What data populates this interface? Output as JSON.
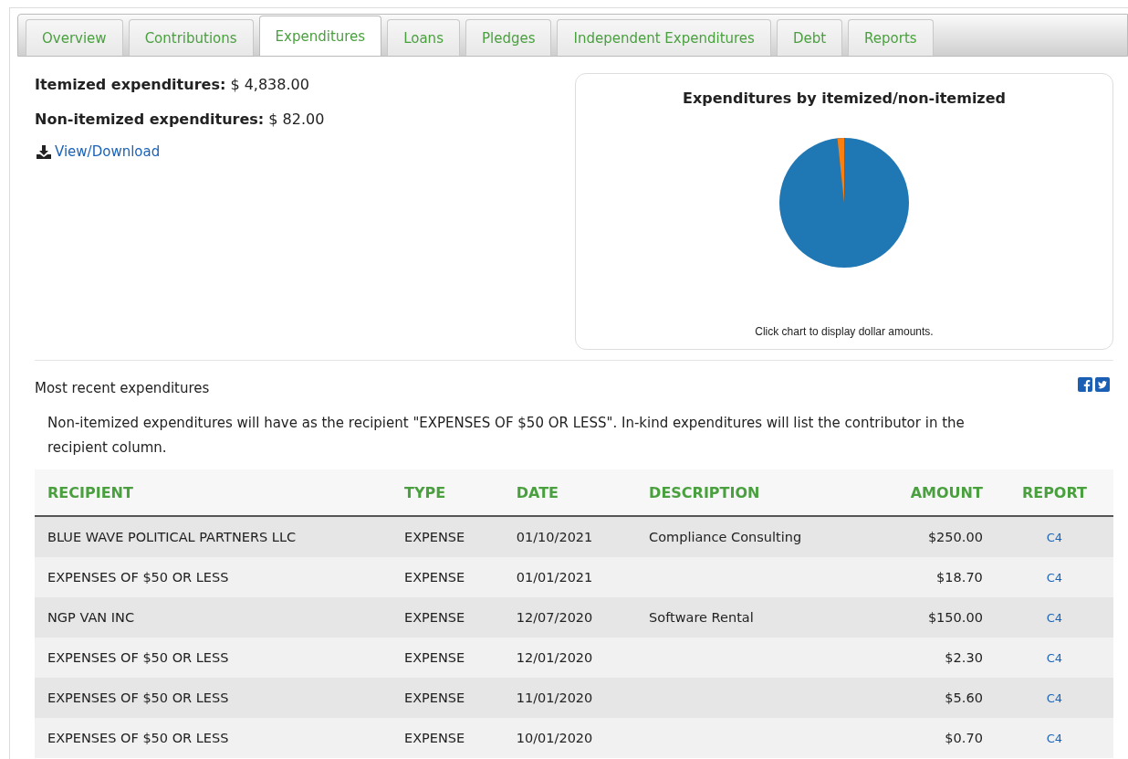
{
  "tabs": [
    {
      "label": "Overview",
      "selected": false
    },
    {
      "label": "Contributions",
      "selected": false
    },
    {
      "label": "Expenditures",
      "selected": true
    },
    {
      "label": "Loans",
      "selected": false
    },
    {
      "label": "Pledges",
      "selected": false
    },
    {
      "label": "Independent Expenditures",
      "selected": false
    },
    {
      "label": "Debt",
      "selected": false
    },
    {
      "label": "Reports",
      "selected": false
    }
  ],
  "summary": [
    {
      "label": "Itemized expenditures:",
      "value": "$ 4,838.00"
    },
    {
      "label": "Non-itemized expenditures:",
      "value": "$ 82.00"
    }
  ],
  "download_link": "View/Download",
  "chart_card": {
    "title": "Expenditures by itemized/non-itemized",
    "caption": "Click chart to display dollar amounts."
  },
  "section_title": "Most recent expenditures",
  "note": "Non-itemized expenditures will have as the recipient \"EXPENSES OF $50 OR LESS\". In-kind expenditures will list the contributor in the recipient column.",
  "table": {
    "columns": [
      "RECIPIENT",
      "TYPE",
      "DATE",
      "DESCRIPTION",
      "AMOUNT",
      "REPORT"
    ],
    "rows": [
      [
        "BLUE WAVE POLITICAL PARTNERS LLC",
        "EXPENSE",
        "01/10/2021",
        "Compliance Consulting",
        "$250.00",
        "C4"
      ],
      [
        "EXPENSES OF $50 OR LESS",
        "EXPENSE",
        "01/01/2021",
        "",
        "$18.70",
        "C4"
      ],
      [
        "NGP VAN INC",
        "EXPENSE",
        "12/07/2020",
        "Software Rental",
        "$150.00",
        "C4"
      ],
      [
        "EXPENSES OF $50 OR LESS",
        "EXPENSE",
        "12/01/2020",
        "",
        "$2.30",
        "C4"
      ],
      [
        "EXPENSES OF $50 OR LESS",
        "EXPENSE",
        "11/01/2020",
        "",
        "$5.60",
        "C4"
      ],
      [
        "EXPENSES OF $50 OR LESS",
        "EXPENSE",
        "10/01/2020",
        "",
        "$0.70",
        "C4"
      ]
    ]
  }
}
